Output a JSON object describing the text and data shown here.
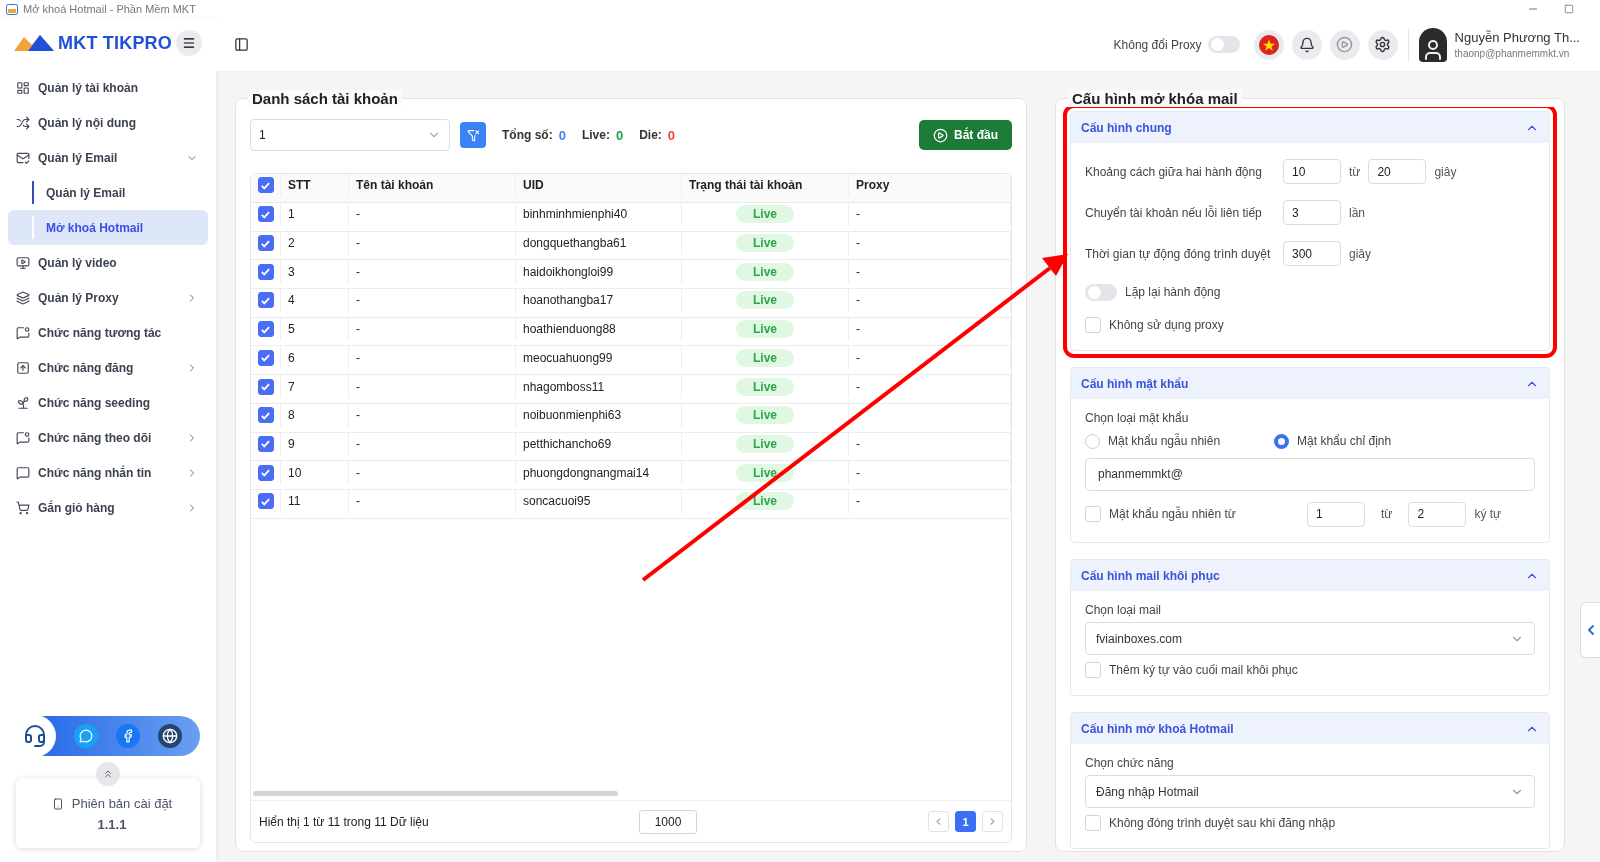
{
  "window": {
    "title": "Mở khoá Hotmail - Phần Mềm MKT"
  },
  "sidebar": {
    "logo": "MKT TIKPRO",
    "items": [
      {
        "label": "Quản lý tài khoản",
        "selected": false
      },
      {
        "label": "Quản lý nội dung",
        "selected": false
      },
      {
        "label": "Quản lý Email",
        "selected": false,
        "expanded": true,
        "children": [
          {
            "label": "Quản lý Email",
            "selected": false
          },
          {
            "label": "Mở khoá Hotmail",
            "selected": true
          }
        ]
      },
      {
        "label": "Quản lý video",
        "selected": false
      },
      {
        "label": "Quản lý Proxy",
        "selected": false,
        "expanded": false
      },
      {
        "label": "Chức năng tương tác",
        "selected": false
      },
      {
        "label": "Chức năng đăng",
        "selected": false,
        "expanded": false
      },
      {
        "label": "Chức năng seeding",
        "selected": false
      },
      {
        "label": "Chức năng theo dõi",
        "selected": false,
        "expanded": false
      },
      {
        "label": "Chức năng nhắn tin",
        "selected": false,
        "expanded": false
      },
      {
        "label": "Gắn giỏ hàng",
        "selected": false,
        "expanded": false
      }
    ],
    "version_card": {
      "label": "Phiên bản cài đặt",
      "version": "1.1.1"
    }
  },
  "header": {
    "proxy_toggle": {
      "label": "Không đổi Proxy",
      "on": false
    },
    "user": {
      "name": "Nguyễn Phương Th...",
      "email": "thaonp@phanmemmkt.vn"
    }
  },
  "accounts": {
    "title": "Danh sách tài khoản",
    "select_value": "1",
    "stats": [
      {
        "label": "Tổng số:",
        "value": "0",
        "color": "#3b82f6"
      },
      {
        "label": "Live:",
        "value": "0",
        "color": "#16a34a"
      },
      {
        "label": "Die:",
        "value": "0",
        "color": "#ef4444"
      }
    ],
    "start_button": "Bắt đầu",
    "all_checked": true,
    "columns": [
      "STT",
      "Tên tài khoản",
      "UID",
      "Trạng thái tài khoản",
      "Proxy"
    ],
    "rows": [
      {
        "checked": true,
        "stt": "1",
        "name": "-",
        "uid": "binhminhmienphi40",
        "status": "Live",
        "proxy": "-"
      },
      {
        "checked": true,
        "stt": "2",
        "name": "-",
        "uid": "dongquethangba61",
        "status": "Live",
        "proxy": "-"
      },
      {
        "checked": true,
        "stt": "3",
        "name": "-",
        "uid": "haidoikhongloi99",
        "status": "Live",
        "proxy": "-"
      },
      {
        "checked": true,
        "stt": "4",
        "name": "-",
        "uid": "hoanothangba17",
        "status": "Live",
        "proxy": "-"
      },
      {
        "checked": true,
        "stt": "5",
        "name": "-",
        "uid": "hoathienduong88",
        "status": "Live",
        "proxy": "-"
      },
      {
        "checked": true,
        "stt": "6",
        "name": "-",
        "uid": "meocuahuong99",
        "status": "Live",
        "proxy": "-"
      },
      {
        "checked": true,
        "stt": "7",
        "name": "-",
        "uid": "nhagomboss11",
        "status": "Live",
        "proxy": "-"
      },
      {
        "checked": true,
        "stt": "8",
        "name": "-",
        "uid": "noibuonmienphi63",
        "status": "Live"
      },
      {
        "checked": true,
        "stt": "9",
        "name": "-",
        "uid": "petthichancho69",
        "status": "Live",
        "proxy": "-"
      },
      {
        "checked": true,
        "stt": "10",
        "name": "-",
        "uid": "phuongdongnangmai14",
        "status": "Live",
        "proxy": "-"
      },
      {
        "checked": true,
        "stt": "11",
        "name": "-",
        "uid": "soncacuoi95",
        "status": "Live",
        "proxy": "-"
      }
    ],
    "footer": {
      "summary": "Hiển thị 1 từ 11 trong 11 Dữ liệu",
      "page_size": "1000",
      "pages": [
        {
          "label": "1",
          "selected": true
        }
      ]
    }
  },
  "config": {
    "title": "Cấu hình mở khóa mail",
    "sections": [
      {
        "title": "Cấu hình chung",
        "expanded": true,
        "highlighted": true,
        "fields": [
          {
            "kind": "range",
            "label": "Khoảng cách giữa hai hành động",
            "from": "10",
            "sep": "từ",
            "to": "20",
            "unit": "giây"
          },
          {
            "kind": "number",
            "label": "Chuyển tài khoản nếu lỗi liên tiếp",
            "value": "3",
            "unit": "lần"
          },
          {
            "kind": "number",
            "label": "Thời gian tự động đóng trình duyệt",
            "value": "300",
            "unit": "giây"
          },
          {
            "kind": "toggle",
            "label": "Lặp lại hành động",
            "on": false
          },
          {
            "kind": "checkbox",
            "label": "Không sử dụng proxy",
            "checked": false
          }
        ]
      },
      {
        "title": "Cấu hình mật khẩu",
        "expanded": true,
        "highlighted": false,
        "fields": [
          {
            "kind": "radio",
            "label": "Chọn loại mật khẩu",
            "options": [
              {
                "label": "Mật khẩu ngẫu nhiên",
                "selected": false
              },
              {
                "label": "Mật khẩu chỉ định",
                "selected": true
              }
            ]
          },
          {
            "kind": "text",
            "value": "phanmemmkt@"
          },
          {
            "kind": "check_range",
            "label": "Mật khẩu ngẫu nhiên từ",
            "checked": false,
            "from": "1",
            "sep": "từ",
            "to": "2",
            "unit": "ký tự"
          }
        ]
      },
      {
        "title": "Cấu hình mail khôi phục",
        "expanded": true,
        "highlighted": false,
        "fields": [
          {
            "kind": "select",
            "label": "Chọn loại mail",
            "value": "fviainboxes.com"
          },
          {
            "kind": "checkbox",
            "label": "Thêm ký tự vào cuối mail khôi phục",
            "checked": false
          }
        ]
      },
      {
        "title": "Cấu hình mở khoá Hotmail",
        "expanded": true,
        "highlighted": false,
        "fields": [
          {
            "kind": "select",
            "label": "Chọn chức năng",
            "value": "Đăng nhập Hotmail"
          },
          {
            "kind": "checkbox",
            "label": "Không đóng trình duyệt sau khi đăng nhập",
            "checked": false
          }
        ]
      }
    ]
  }
}
